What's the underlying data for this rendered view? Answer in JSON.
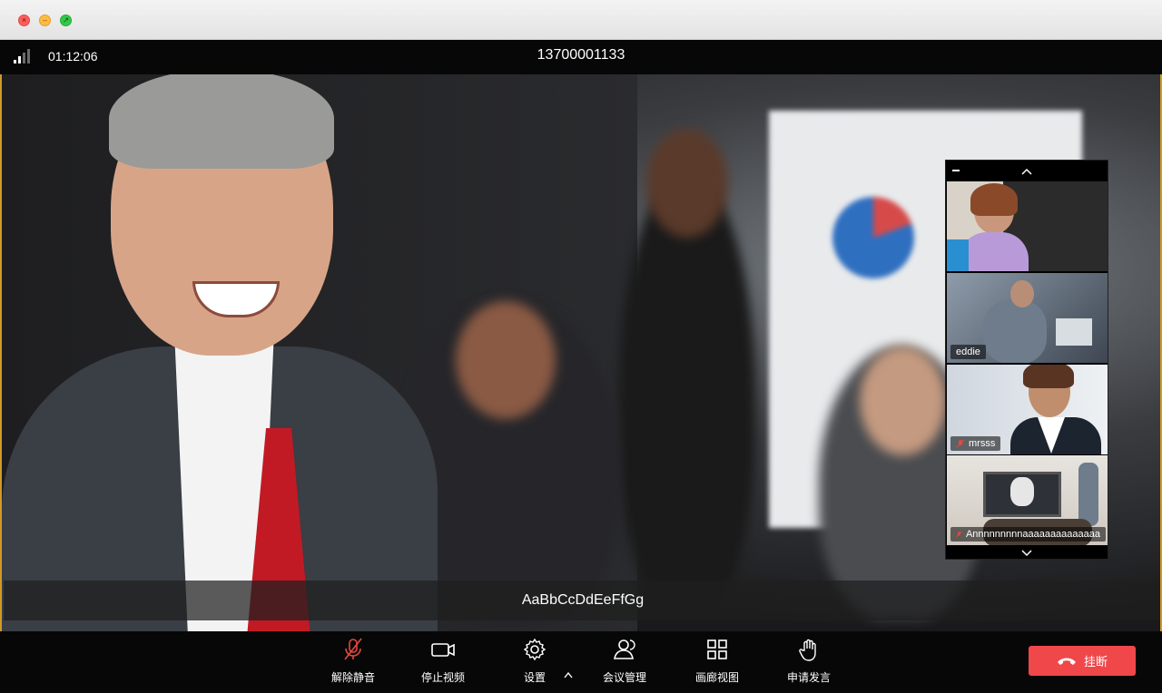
{
  "window": {
    "controls": [
      "close",
      "minimize",
      "maximize"
    ]
  },
  "status_bar": {
    "call_time": "01:12:06",
    "call_number": "13700001133",
    "signal_icon": "signal-strength-icon"
  },
  "main_video": {
    "subtitle": "AaBbCcDdEeFfGg",
    "highlight_color": "#d19a28"
  },
  "gallery": {
    "tiles": [
      {
        "label": ""
      },
      {
        "label": "eddie",
        "muted": false
      },
      {
        "label": "mrsss",
        "muted": true
      },
      {
        "label": "Annnnnnnnnaaaaaaaaaaaaaa",
        "muted": true
      }
    ]
  },
  "toolbar": {
    "unmute_label": "解除静音",
    "stop_video_label": "停止视频",
    "settings_label": "设置",
    "meeting_manage_label": "会议管理",
    "gallery_view_label": "画廊视图",
    "raise_hand_label": "申请发言",
    "hangup_label": "挂断",
    "hangup_color": "#f0474a",
    "unmute_icon_color": "#e8473f"
  }
}
